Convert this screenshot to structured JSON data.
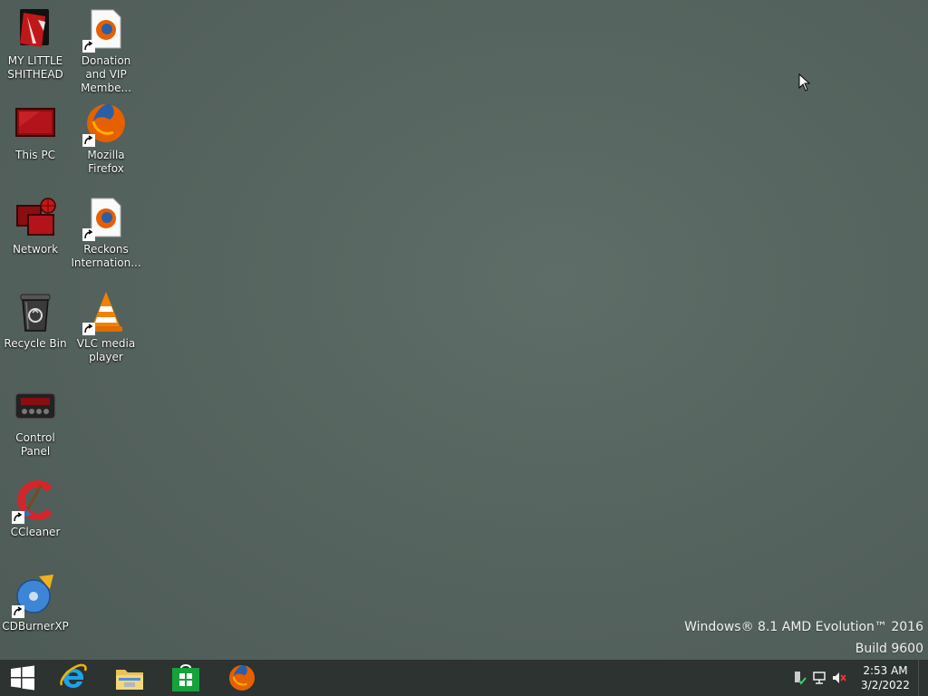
{
  "desktop_icons": [
    {
      "label": "MY LITTLE SHITHEAD",
      "icon": "red-folder-icon"
    },
    {
      "label": "Donation and VIP Membe...",
      "icon": "firefox-document-icon"
    },
    {
      "label": "This PC",
      "icon": "this-pc-icon"
    },
    {
      "label": "Mozilla Firefox",
      "icon": "firefox-icon"
    },
    {
      "label": "Network",
      "icon": "network-icon"
    },
    {
      "label": "Reckons Internation...",
      "icon": "firefox-document-icon"
    },
    {
      "label": "Recycle Bin",
      "icon": "recycle-bin-icon"
    },
    {
      "label": "VLC media player",
      "icon": "vlc-icon"
    },
    {
      "label": "Control Panel",
      "icon": "control-panel-icon"
    },
    {
      "label": "CCleaner",
      "icon": "ccleaner-icon"
    },
    {
      "label": "CDBurnerXP",
      "icon": "cdburnerxp-icon"
    }
  ],
  "watermark": {
    "line1": "Windows® 8.1 AMD Evolution™ 2016",
    "line2": "Build 9600"
  },
  "taskbar": {
    "pinned": [
      "start-button",
      "internet-explorer-icon",
      "file-explorer-icon",
      "store-icon",
      "firefox-icon"
    ],
    "tray": [
      "action-center-icon",
      "network-icon",
      "volume-muted-icon"
    ],
    "time": "2:53 AM",
    "date": "3/2/2022"
  },
  "colors": {
    "desktop_bg": "#56645f",
    "taskbar_bg": "#2c3331",
    "accent_red": "#b3141b"
  }
}
